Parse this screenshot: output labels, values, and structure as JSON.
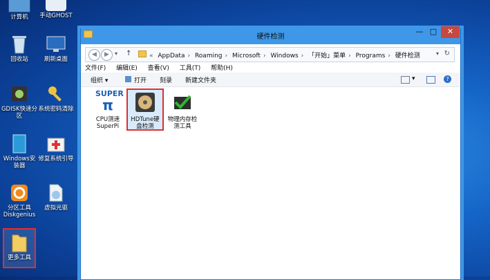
{
  "desktop": {
    "icons": [
      {
        "label": "计算机"
      },
      {
        "label": "手动GHOST"
      },
      {
        "label": "回收站"
      },
      {
        "label": "刷新桌面"
      },
      {
        "label": "GDISK快速分\n区"
      },
      {
        "label": "系统密码清除"
      },
      {
        "label": "Windows安\n装器"
      },
      {
        "label": "修复系统引导"
      },
      {
        "label": "分区工具\nDiskgenius"
      },
      {
        "label": "虚拟光驱"
      },
      {
        "label": "更多工具"
      }
    ]
  },
  "window": {
    "title": "硬件检测",
    "minimize": "—",
    "maximize": "□",
    "close": "✕",
    "breadcrumbs": [
      "AppData",
      "Roaming",
      "Microsoft",
      "Windows",
      "「开始」菜单",
      "Programs",
      "硬件检测"
    ],
    "menu": [
      "文件(F)",
      "编辑(E)",
      "查看(V)",
      "工具(T)",
      "帮助(H)"
    ],
    "commands": {
      "organize": "组织 ▾",
      "open": "打开",
      "burn": "刻录",
      "new_folder": "新建文件夹"
    },
    "files": [
      {
        "label": "CPU测速\nSuperPi",
        "icon_text": "SUPER"
      },
      {
        "label": "HDTune硬\n盘检测"
      },
      {
        "label": "物理内存检\n测工具"
      }
    ]
  },
  "colors": {
    "accent": "#3e97e8",
    "close": "#c7483e",
    "selection": "#e03030"
  }
}
